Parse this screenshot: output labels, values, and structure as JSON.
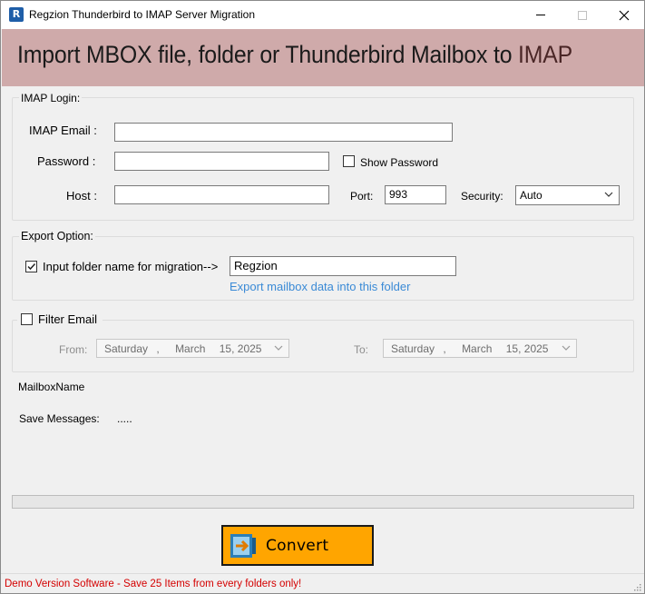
{
  "window": {
    "app_icon_letter": "R",
    "title": "Regzion Thunderbird to IMAP Server Migration"
  },
  "banner": {
    "text_main": "Import MBOX file, folder or Thunderbird Mailbox to ",
    "text_accent": "IMAP"
  },
  "imap_login": {
    "legend": "IMAP Login:",
    "email_label": "IMAP Email :",
    "email_value": "",
    "password_label": "Password :",
    "password_value": "",
    "show_password_label": "Show Password",
    "show_password_checked": false,
    "host_label": "Host :",
    "host_value": "",
    "port_label": "Port:",
    "port_value": "993",
    "security_label": "Security:",
    "security_value": "Auto"
  },
  "export_option": {
    "legend": "Export Option:",
    "folder_checkbox_label": "Input folder name for migration-->",
    "folder_checkbox_checked": true,
    "folder_value": "Regzion",
    "hint_link": "Export mailbox data into this folder"
  },
  "filter": {
    "legend": "Filter Email",
    "checked": false,
    "from_label": "From:",
    "from_date": {
      "weekday": "Saturday",
      "sep": ",",
      "month": "March",
      "day_year": "15, 2025"
    },
    "to_label": "To:",
    "to_date": {
      "weekday": "Saturday",
      "sep": ",",
      "month": "March",
      "day_year": "15, 2025"
    }
  },
  "info": {
    "mailbox_label": "MailboxName",
    "save_messages_label": "Save Messages:",
    "save_messages_value": "....."
  },
  "progress": {
    "percent": 0
  },
  "actions": {
    "convert_label": "Convert"
  },
  "status": {
    "text": "Demo Version Software - Save 25 Items from every folders only!",
    "color": "#d40000"
  },
  "colors": {
    "banner_bg": "#cfaaaa",
    "convert_bg": "#ffa500",
    "link": "#3a8ad6",
    "window_bg": "#f0f0f0"
  }
}
